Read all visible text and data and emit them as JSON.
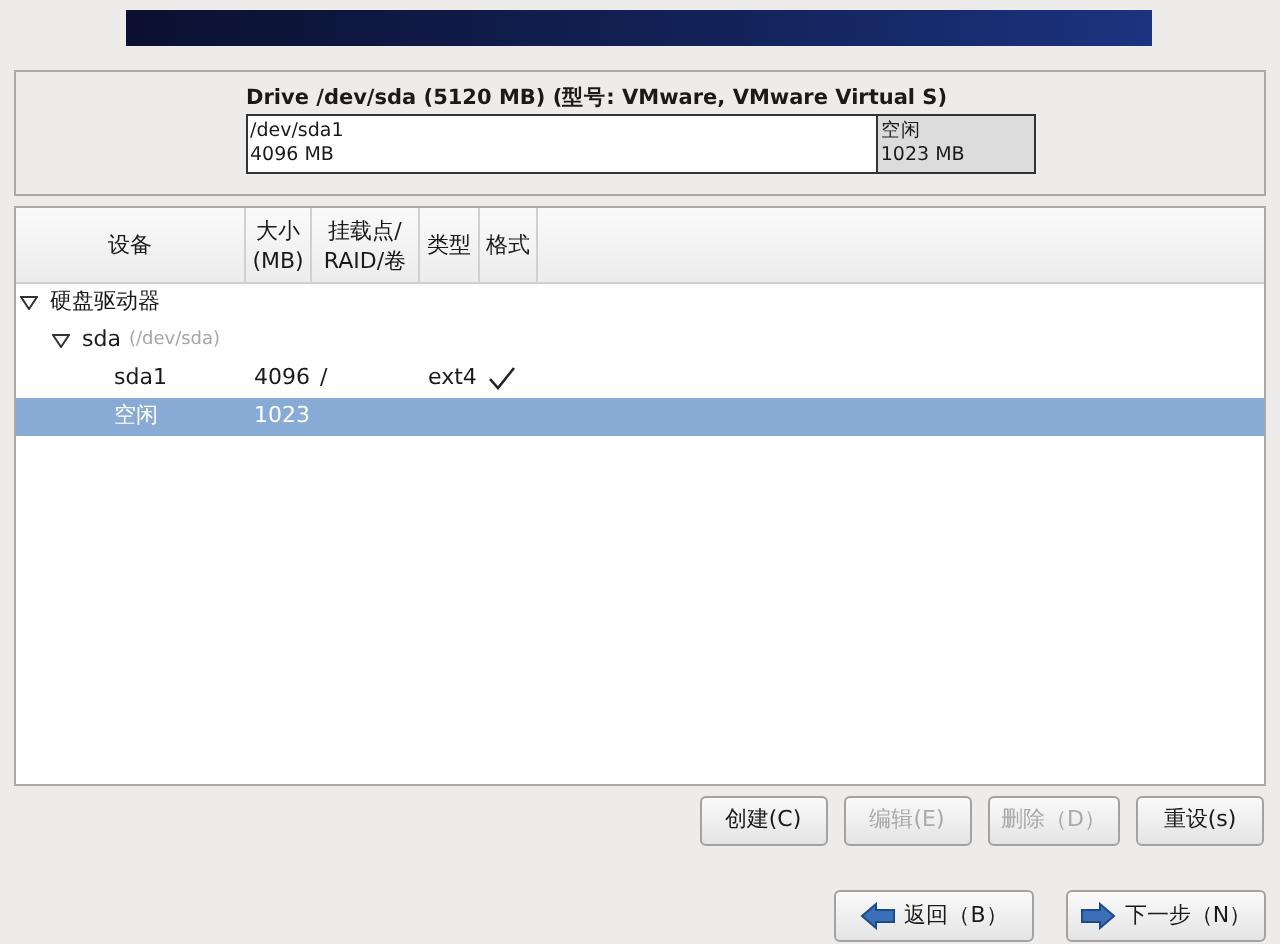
{
  "drive": {
    "title": "Drive /dev/sda (5120 MB) (型号: VMware, VMware Virtual S)",
    "segments": [
      {
        "name": "/dev/sda1",
        "size": "4096 MB",
        "level": 0.8,
        "kind": "partition"
      },
      {
        "name": "空闲",
        "size": "1023 MB",
        "level": 0.2,
        "kind": "free"
      }
    ]
  },
  "table": {
    "columns": [
      "设备",
      "大小\n(MB)",
      "挂载点/\nRAID/卷",
      "类型",
      "格式"
    ],
    "rows": [
      {
        "device": "硬盘驱动器",
        "expanded": true,
        "selected": false,
        "children": [
          {
            "device": "sda",
            "path": "(/dev/sda)",
            "expanded": true,
            "selected": false,
            "children": [
              {
                "device": "sda1",
                "size": "4096",
                "mount": "/",
                "type": "ext4",
                "format": true,
                "selected": false
              },
              {
                "device": "空闲",
                "size": "1023",
                "format": false,
                "selected": true
              }
            ]
          }
        ]
      }
    ]
  },
  "actions": [
    {
      "label": "创建(C)",
      "disabled": false
    },
    {
      "label": "编辑(E)",
      "disabled": true
    },
    {
      "label": "删除（D）",
      "disabled": true
    },
    {
      "label": "重设(s)",
      "disabled": false
    }
  ],
  "navigation": [
    {
      "label": "返回（B）",
      "kind": "back"
    },
    {
      "label": "下一步（N）",
      "kind": "next"
    }
  ]
}
